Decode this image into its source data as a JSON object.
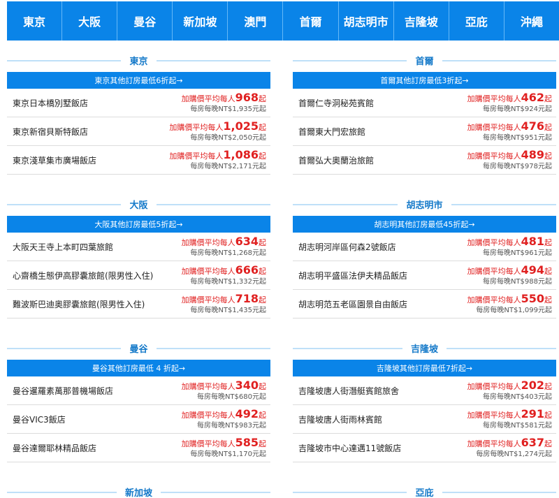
{
  "nav": {
    "cities": [
      "東京",
      "大阪",
      "曼谷",
      "新加坡",
      "澳門",
      "首爾",
      "胡志明市",
      "吉隆坡",
      "亞庇",
      "沖繩"
    ]
  },
  "price": {
    "prefix": "加購價平均每人",
    "suffix": "起"
  },
  "left": [
    {
      "city": "東京",
      "promo": "東京其他訂房最低6折起→",
      "hotels": [
        {
          "name": "東京日本橋別墅飯店",
          "amount": "968",
          "sub": "每房每晚NT$1,935元起"
        },
        {
          "name": "東京新宿貝斯特飯店",
          "amount": "1,025",
          "sub": "每房每晚NT$2,050元起"
        },
        {
          "name": "東京淺草集市廣場飯店",
          "amount": "1,086",
          "sub": "每房每晚NT$2,171元起"
        }
      ]
    },
    {
      "city": "大阪",
      "promo": "大阪其他訂房最低5折起→",
      "hotels": [
        {
          "name": "大阪天王寺上本町四葉旅館",
          "amount": "634",
          "sub": "每房每晚NT$1,268元起"
        },
        {
          "name": "心齋橋生態伊高膠囊旅館(限男性入住)",
          "amount": "666",
          "sub": "每房每晚NT$1,332元起"
        },
        {
          "name": "難波斯巴迪奧膠囊旅館(限男性入住)",
          "amount": "718",
          "sub": "每房每晚NT$1,435元起"
        }
      ]
    },
    {
      "city": "曼谷",
      "promo": "曼谷其他訂房最低 4 折起→",
      "hotels": [
        {
          "name": "曼谷暹羅素萬那普機場飯店",
          "amount": "340",
          "sub": "每房每晚NT$680元起"
        },
        {
          "name": "曼谷VIC3飯店",
          "amount": "492",
          "sub": "每房每晚NT$983元起"
        },
        {
          "name": "曼谷達爾耶林精品飯店",
          "amount": "585",
          "sub": "每房每晚NT$1,170元起"
        }
      ]
    },
    {
      "city": "新加坡"
    }
  ],
  "right": [
    {
      "city": "首爾",
      "promo": "首爾其他訂房最低3折起→",
      "hotels": [
        {
          "name": "首爾仁寺洞秘苑賓館",
          "amount": "462",
          "sub": "每房每晚NT$924元起"
        },
        {
          "name": "首爾東大門宏旅館",
          "amount": "476",
          "sub": "每房每晚NT$951元起"
        },
        {
          "name": "首爾弘大奧蘭治旅館",
          "amount": "489",
          "sub": "每房每晚NT$978元起"
        }
      ]
    },
    {
      "city": "胡志明市",
      "promo": "胡志明其他訂房最低45折起→",
      "hotels": [
        {
          "name": "胡志明河岸區何森2號飯店",
          "amount": "481",
          "sub": "每房每晚NT$961元起"
        },
        {
          "name": "胡志明平盛區法伊夫精品飯店",
          "amount": "494",
          "sub": "每房每晚NT$988元起"
        },
        {
          "name": "胡志明范五老區園景自由飯店",
          "amount": "550",
          "sub": "每房每晚NT$1,099元起"
        }
      ]
    },
    {
      "city": "吉隆坡",
      "promo": "吉隆坡其他訂房最低7折起→",
      "hotels": [
        {
          "name": "吉隆坡唐人街潛艇賓館旅舍",
          "amount": "202",
          "sub": "每房每晚NT$403元起"
        },
        {
          "name": "吉隆坡唐人街雨林賓館",
          "amount": "291",
          "sub": "每房每晚NT$581元起"
        },
        {
          "name": "吉隆坡市中心達邁11號飯店",
          "amount": "637",
          "sub": "每房每晚NT$1,274元起"
        }
      ]
    },
    {
      "city": "亞庇"
    }
  ]
}
